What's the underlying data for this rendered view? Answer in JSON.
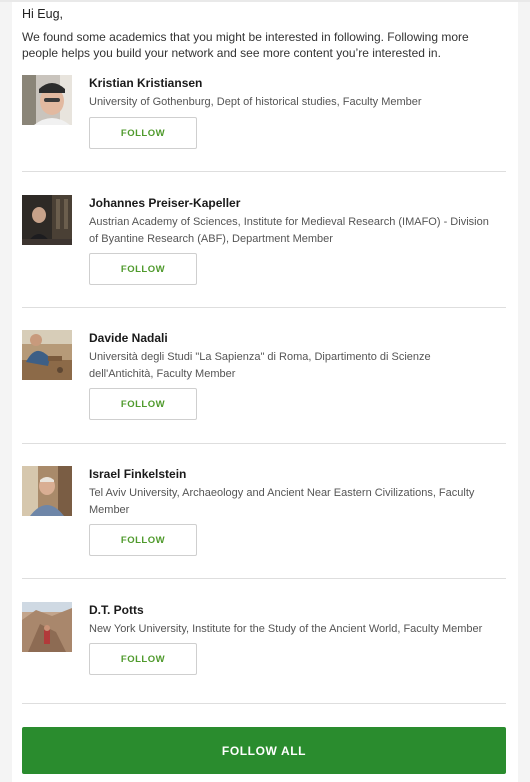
{
  "greeting": "Hi Eug,",
  "intro": "We found some academics that you might be interested in following. Following more people helps you build your network and see more content you’re interested in.",
  "people": [
    {
      "name": "Kristian Kristiansen",
      "affiliation": "University of Gothenburg, Dept of historical studies, Faculty Member",
      "follow_label": "FOLLOW"
    },
    {
      "name": "Johannes Preiser-Kapeller",
      "affiliation": "Austrian Academy of Sciences, Institute for Medieval Research (IMAFO) - Division of Byantine Research (ABF), Department Member",
      "follow_label": "FOLLOW"
    },
    {
      "name": "Davide Nadali",
      "affiliation": "Università degli Studi \"La Sapienza\" di Roma, Dipartimento di Scienze dell'Antichità, Faculty Member",
      "follow_label": "FOLLOW"
    },
    {
      "name": "Israel Finkelstein",
      "affiliation": "Tel Aviv University, Archaeology and Ancient Near Eastern Civilizations, Faculty Member",
      "follow_label": "FOLLOW"
    },
    {
      "name": "D.T. Potts",
      "affiliation": "New York University, Institute for the Study of the Ancient World, Faculty Member",
      "follow_label": "FOLLOW"
    }
  ],
  "follow_all_label": "FOLLOW ALL",
  "colors": {
    "accent_green": "#2a8c2e",
    "follow_text_green": "#4f9a2c"
  }
}
